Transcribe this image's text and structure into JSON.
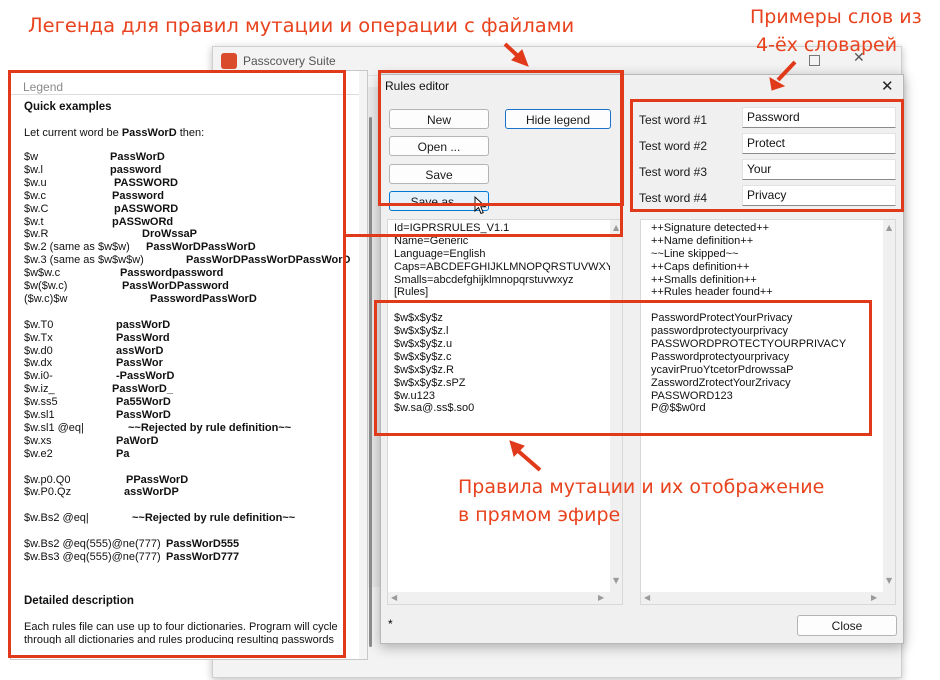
{
  "annotations": {
    "legend_caption": "Легенда для правил мутации и операции с файлами",
    "words_caption_line1": "Примеры слов из",
    "words_caption_line2": "4-ёх словарей",
    "rules_caption_line1": "Правила мутации и их отображение",
    "rules_caption_line2": "в прямом эфире",
    "accent_color": "#e03a1a"
  },
  "bg_window": {
    "title": "Passcovery Suite"
  },
  "rules_editor": {
    "title": "Rules editor",
    "close_glyph": "✕",
    "buttons": {
      "new": "New",
      "hide_legend": "Hide legend",
      "open": "Open ...",
      "save": "Save",
      "save_as": "Save as ..."
    },
    "test_words": [
      {
        "label": "Test word #1",
        "value": "Password"
      },
      {
        "label": "Test word #2",
        "value": "Protect"
      },
      {
        "label": "Test word #3",
        "value": "Your"
      },
      {
        "label": "Test word #4",
        "value": "Privacy"
      }
    ],
    "rules_lines": [
      "Id=IGPRSRULES_V1.1",
      "Name=Generic",
      "Language=English",
      "Caps=ABCDEFGHIJKLMNOPQRSTUVWXYZ",
      "Smalls=abcdefghijklmnopqrstuvwxyz",
      "[Rules]",
      "",
      "$w$x$y$z",
      "$w$x$y$z.l",
      "$w$x$y$z.u",
      "$w$x$y$z.c",
      "$w$x$y$z.R",
      "$w$x$y$z.sPZ",
      "$w.u123",
      "$w.sa@.ss$.so0"
    ],
    "output_lines": [
      "++Signature detected++",
      "++Name definition++",
      "~~Line skipped~~",
      "++Caps definition++",
      "++Smalls definition++",
      "++Rules header found++",
      "",
      "PasswordProtectYourPrivacy",
      "passwordprotectyourprivacy",
      "PASSWORDPROTECTYOURPRIVACY",
      "Passwordprotectyourprivacy",
      "ycavirPruoYtcetorPdrowssaP",
      "ZasswordZrotectYourZrivacy",
      "PASSWORD123",
      "P@$$w0rd"
    ],
    "status": "*",
    "close_button": "Close"
  },
  "legend": {
    "title": "Legend",
    "heading": "Quick examples",
    "intro_prefix": "Let current word be ",
    "intro_word": "PassWorD",
    "intro_suffix": " then:",
    "examples": [
      {
        "rule": "$w",
        "result": "PassWorD"
      },
      {
        "rule": "$w.l",
        "result": "password"
      },
      {
        "rule": "$w.u",
        "result": "PASSWORD"
      },
      {
        "rule": "$w.c",
        "result": "Password"
      },
      {
        "rule": "$w.C",
        "result": "pASSWORD"
      },
      {
        "rule": "$w.t",
        "result": "pASSwORd"
      },
      {
        "rule": "$w.R",
        "result": "DroWssaP"
      },
      {
        "rule": "$w.2 (same as $w$w)",
        "result": "PassWorDPassWorD"
      },
      {
        "rule": "$w.3 (same as $w$w$w)",
        "result": "PassWorDPassWorDPassWorD"
      },
      {
        "rule": "$w$w.c",
        "result": "Passwordpassword"
      },
      {
        "rule": "$w($w.c)",
        "result": "PassWorDPassword"
      },
      {
        "rule": "($w.c)$w",
        "result": "PasswordPassWorD"
      },
      {
        "rule": "",
        "result": ""
      },
      {
        "rule": "$w.T0",
        "result": "passWorD"
      },
      {
        "rule": "$w.Tx",
        "result": "PassWord"
      },
      {
        "rule": "$w.d0",
        "result": "assWorD"
      },
      {
        "rule": "$w.dx",
        "result": "PassWor"
      },
      {
        "rule": "$w.i0-",
        "result": "-PassWorD"
      },
      {
        "rule": "$w.iz_",
        "result": "PassWorD_"
      },
      {
        "rule": "$w.ss5",
        "result": "Pa55WorD"
      },
      {
        "rule": "$w.sl1",
        "result": "PassWorD"
      },
      {
        "rule": "$w.sl1 @eq|",
        "result": "~~Rejected by rule definition~~"
      },
      {
        "rule": "$w.xs",
        "result": "PaWorD"
      },
      {
        "rule": "$w.e2",
        "result": "Pa"
      },
      {
        "rule": "",
        "result": ""
      },
      {
        "rule": "$w.p0.Q0",
        "result": "PPassWorD"
      },
      {
        "rule": "$w.P0.Qz",
        "result": "assWorDP"
      },
      {
        "rule": "",
        "result": ""
      },
      {
        "rule": "$w.Bs2 @eq|",
        "result": "~~Rejected by rule definition~~"
      },
      {
        "rule": "",
        "result": ""
      },
      {
        "rule": "$w.Bs2 @eq(555)@ne(777)",
        "result": "PassWorD555"
      },
      {
        "rule": "$w.Bs3 @eq(555)@ne(777)",
        "result": "PassWorD777"
      }
    ],
    "detailed_heading": "Detailed description",
    "detailed_line1": "Each rules file can use up to four dictionaries. Program will cycle",
    "detailed_line2": "through all dictionaries and rules producing resulting passwords"
  }
}
